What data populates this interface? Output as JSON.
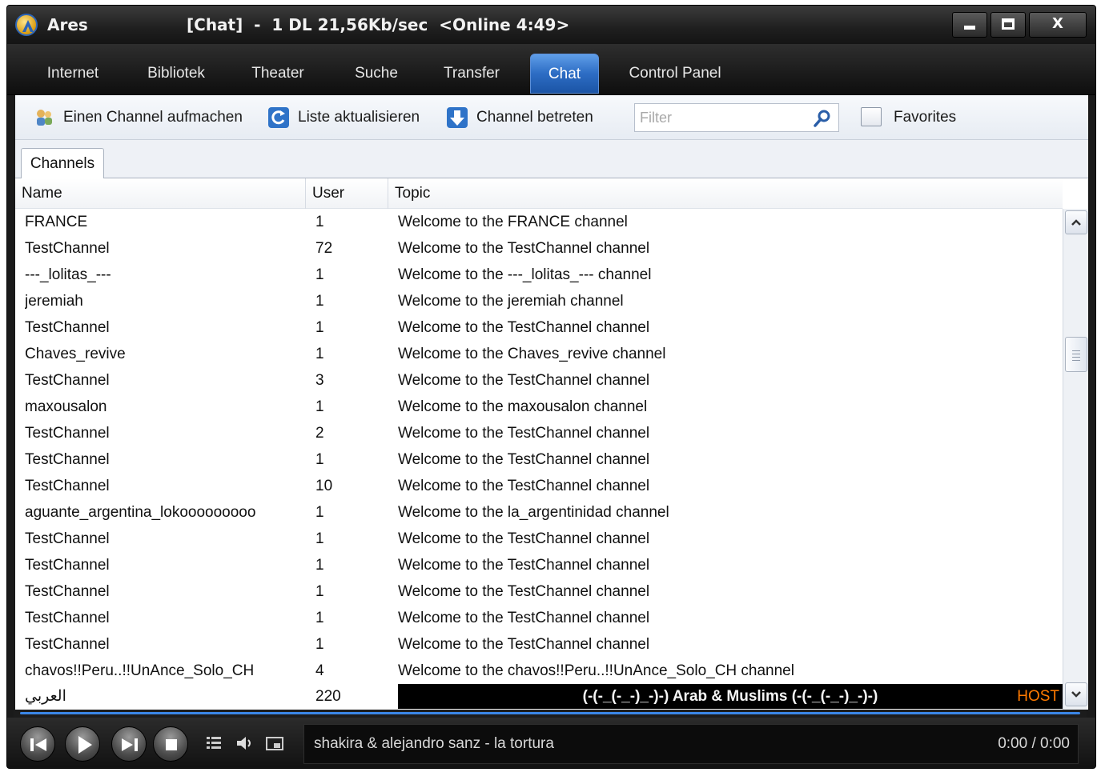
{
  "window": {
    "app_name": "Ares",
    "status": "[Chat]  -  1 DL 21,56Kb/sec  <Online 4:49>",
    "min_symbol": "",
    "max_symbol": "",
    "close_symbol": "X"
  },
  "nav": {
    "items": [
      {
        "label": "Internet"
      },
      {
        "label": "Bibliotek"
      },
      {
        "label": "Theater"
      },
      {
        "label": "Suche"
      },
      {
        "label": "Transfer"
      },
      {
        "label": "Chat"
      },
      {
        "label": "Control Panel"
      }
    ],
    "active": "Chat"
  },
  "toolbar": {
    "open_channel": "Einen Channel aufmachen",
    "refresh_list": "Liste aktualisieren",
    "join_channel": "Channel betreten",
    "filter_placeholder": "Filter",
    "favorites": "Favorites"
  },
  "tabs": {
    "channels": "Channels"
  },
  "table": {
    "columns": [
      "Name",
      "User",
      "Topic"
    ],
    "rows": [
      {
        "name": "FRANCE",
        "user": "1",
        "topic": "Welcome to the FRANCE channel"
      },
      {
        "name": "TestChannel",
        "user": "72",
        "topic": "Welcome to the TestChannel channel"
      },
      {
        "name": "---_lolitas_---",
        "user": "1",
        "topic": "Welcome to the ---_lolitas_--- channel"
      },
      {
        "name": "jeremiah",
        "user": "1",
        "topic": "Welcome to the jeremiah channel"
      },
      {
        "name": "TestChannel",
        "user": "1",
        "topic": "Welcome to the TestChannel channel"
      },
      {
        "name": "Chaves_revive",
        "user": "1",
        "topic": "Welcome to the Chaves_revive channel"
      },
      {
        "name": "TestChannel",
        "user": "3",
        "topic": "Welcome to the TestChannel channel"
      },
      {
        "name": "maxousalon",
        "user": "1",
        "topic": "Welcome to the maxousalon channel"
      },
      {
        "name": "TestChannel",
        "user": "2",
        "topic": "Welcome to the TestChannel channel"
      },
      {
        "name": "TestChannel",
        "user": "1",
        "topic": "Welcome to the TestChannel channel"
      },
      {
        "name": "TestChannel",
        "user": "10",
        "topic": "Welcome to the TestChannel channel"
      },
      {
        "name": "aguante_argentina_lokooooooooo",
        "user": "1",
        "topic": "Welcome to the la_argentinidad channel"
      },
      {
        "name": "TestChannel",
        "user": "1",
        "topic": "Welcome to the TestChannel channel"
      },
      {
        "name": "TestChannel",
        "user": "1",
        "topic": "Welcome to the TestChannel channel"
      },
      {
        "name": "TestChannel",
        "user": "1",
        "topic": "Welcome to the TestChannel channel"
      },
      {
        "name": "TestChannel",
        "user": "1",
        "topic": "Welcome to the TestChannel channel"
      },
      {
        "name": "TestChannel",
        "user": "1",
        "topic": "Welcome to the TestChannel channel"
      },
      {
        "name": "chavos!!Peru..!!UnAnce_Solo_CH",
        "user": "4",
        "topic": "Welcome to the chavos!!Peru..!!UnAnce_Solo_CH channel"
      },
      {
        "name": "العربي",
        "user": "220",
        "topic": "(-(-_(-_-)_-)-)  Arab & Muslims  (-(-_(-_-)_-)-)",
        "topic_suffix": "HOST",
        "banner": true
      }
    ]
  },
  "player": {
    "now_playing": "shakira & alejandro sanz - la tortura",
    "time": "0:00 / 0:00"
  },
  "colors": {
    "accent": "#2d6dc4",
    "host": "#ff7a00",
    "progress": "#3b86e6"
  }
}
